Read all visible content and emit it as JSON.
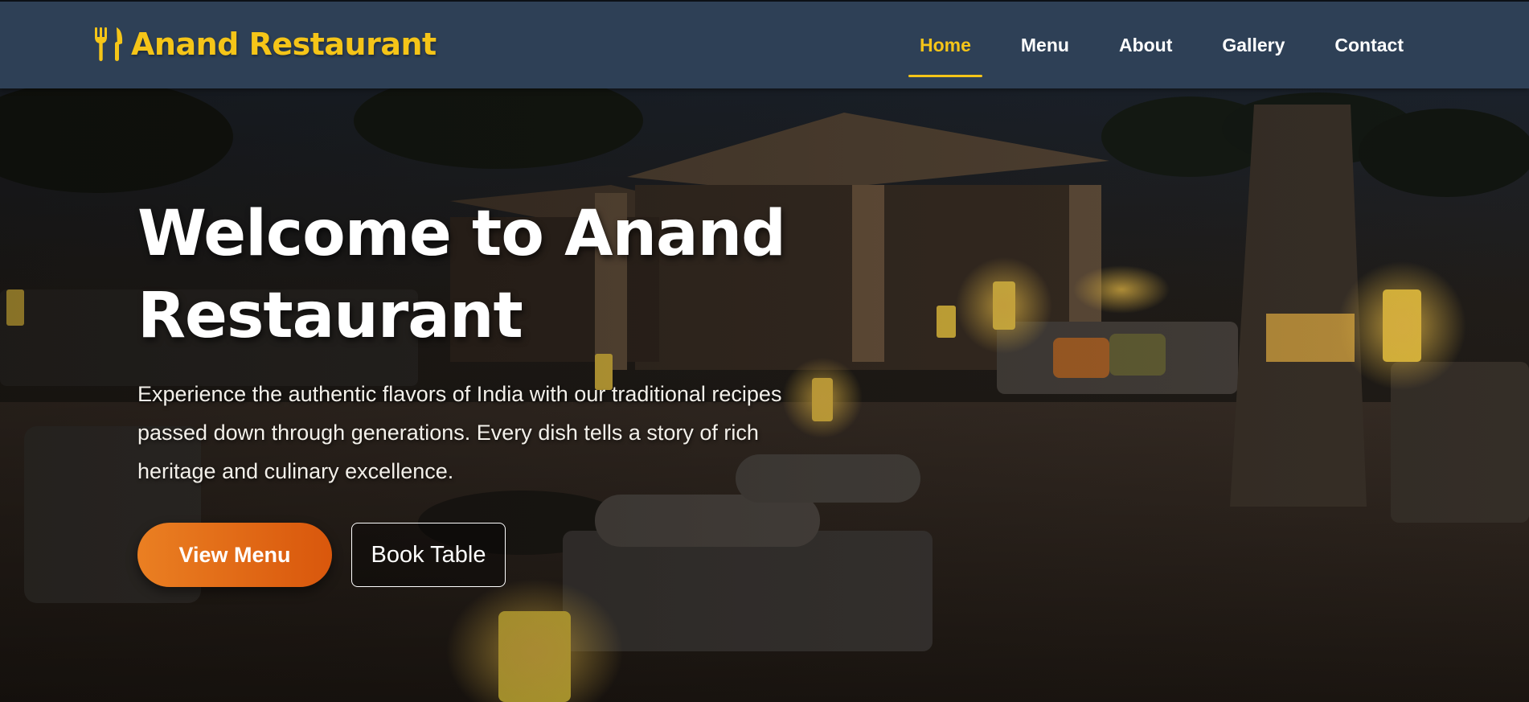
{
  "brand": {
    "name": "Anand Restaurant",
    "icon": "utensils-icon",
    "color": "#f5c518"
  },
  "nav": {
    "items": [
      {
        "label": "Home",
        "active": true
      },
      {
        "label": "Menu",
        "active": false
      },
      {
        "label": "About",
        "active": false
      },
      {
        "label": "Gallery",
        "active": false
      },
      {
        "label": "Contact",
        "active": false
      }
    ]
  },
  "hero": {
    "title_line1": "Welcome to Anand",
    "title_line2": "Restaurant",
    "description": "Experience the authentic flavors of India with our traditional recipes passed down through generations. Every dish tells a story of rich heritage and culinary excellence.",
    "primary_button": "View Menu",
    "secondary_button": "Book Table"
  },
  "colors": {
    "header_bg": "#2e4056",
    "accent": "#f5c518",
    "button_gradient_start": "#ea7f22",
    "button_gradient_end": "#d9570c"
  }
}
